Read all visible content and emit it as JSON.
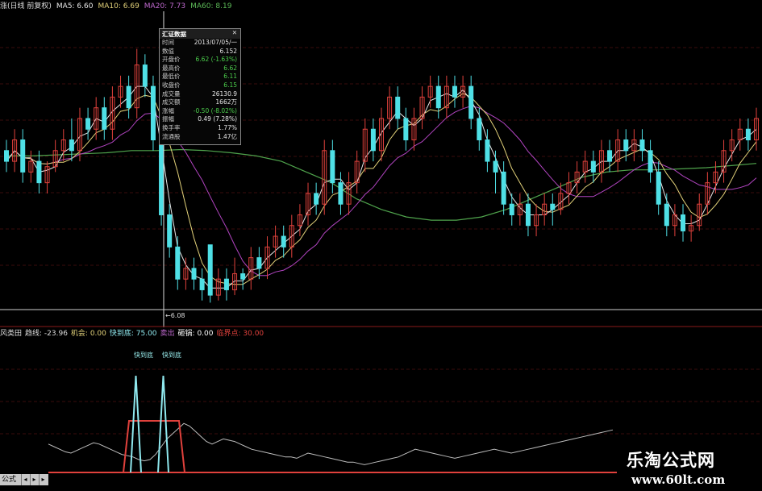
{
  "main_legend": {
    "prefix": "涨(日线 前复权)",
    "ma5": "MA5: 6.60",
    "ma10": "MA10: 6.69",
    "ma20": "MA20: 7.73",
    "ma60": "MA60: 8.19"
  },
  "info_panel": {
    "title": "汇证数据",
    "close": "✕",
    "rows": [
      {
        "label": "时间",
        "value": "2013/07/05/一"
      },
      {
        "label": "数值",
        "value": "6.152"
      },
      {
        "label": "开盘价",
        "value": "6.62 (-1.63%)"
      },
      {
        "label": "最高价",
        "value": "6.62"
      },
      {
        "label": "最低价",
        "value": "6.11"
      },
      {
        "label": "收盘价",
        "value": "6.15"
      },
      {
        "label": "成交量",
        "value": "26130.9"
      },
      {
        "label": "成交额",
        "value": "1662万"
      },
      {
        "label": "涨幅",
        "value": "-0.50 (-8.02%)"
      },
      {
        "label": "振幅",
        "value": "0.49 (7.28%)"
      },
      {
        "label": "换手率",
        "value": "1.77%"
      },
      {
        "label": "流通股",
        "value": "1.47亿"
      }
    ]
  },
  "low_label": "←6.08",
  "indicator_legend": {
    "name": "风类田",
    "trend": "趋线: -23.96",
    "chance": "机会: 0.00",
    "quick": "快到底: 75.00",
    "sell": "卖出",
    "buy": "砸锅: 0.00",
    "critical": "临界点: 30.00"
  },
  "signal_labels": [
    "快到底",
    "快到底"
  ],
  "bottom_bar": {
    "label": "公式",
    "btn1": "◂",
    "btn2": "▸",
    "btn3": "▸"
  },
  "watermark": {
    "title": "乐淘公式网",
    "url": "www.60lt.com"
  },
  "colors": {
    "up": "#e0413c",
    "down": "#4fe0e6",
    "ma5": "#e8e8e8",
    "ma10": "#e3d27a",
    "ma20": "#b144c0",
    "ma60": "#4fa34c"
  },
  "chart_data": {
    "type": "candlestick",
    "candles": [
      {
        "o": 7.5,
        "c": 7.4,
        "h": 7.6,
        "l": 7.3
      },
      {
        "o": 7.4,
        "c": 7.6,
        "h": 7.7,
        "l": 7.3
      },
      {
        "o": 7.6,
        "c": 7.3,
        "h": 7.7,
        "l": 7.2
      },
      {
        "o": 7.3,
        "c": 7.4,
        "h": 7.5,
        "l": 7.2
      },
      {
        "o": 7.4,
        "c": 7.2,
        "h": 7.5,
        "l": 7.1
      },
      {
        "o": 7.2,
        "c": 7.35,
        "h": 7.4,
        "l": 7.1
      },
      {
        "o": 7.35,
        "c": 7.5,
        "h": 7.6,
        "l": 7.3
      },
      {
        "o": 7.5,
        "c": 7.6,
        "h": 7.7,
        "l": 7.4
      },
      {
        "o": 7.6,
        "c": 7.5,
        "h": 7.8,
        "l": 7.4
      },
      {
        "o": 7.5,
        "c": 7.8,
        "h": 7.9,
        "l": 7.4
      },
      {
        "o": 7.8,
        "c": 7.7,
        "h": 7.9,
        "l": 7.6
      },
      {
        "o": 7.7,
        "c": 7.9,
        "h": 8.0,
        "l": 7.6
      },
      {
        "o": 7.9,
        "c": 7.7,
        "h": 8.0,
        "l": 7.6
      },
      {
        "o": 7.7,
        "c": 8.0,
        "h": 8.1,
        "l": 7.6
      },
      {
        "o": 8.0,
        "c": 8.1,
        "h": 8.2,
        "l": 7.9
      },
      {
        "o": 8.1,
        "c": 7.9,
        "h": 8.2,
        "l": 7.8
      },
      {
        "o": 7.9,
        "c": 8.3,
        "h": 8.45,
        "l": 7.8
      },
      {
        "o": 8.3,
        "c": 8.1,
        "h": 8.4,
        "l": 8.0
      },
      {
        "o": 8.1,
        "c": 7.6,
        "h": 8.2,
        "l": 7.5
      },
      {
        "o": 7.6,
        "c": 6.9,
        "h": 7.7,
        "l": 6.8
      },
      {
        "o": 6.9,
        "c": 6.6,
        "h": 7.0,
        "l": 6.5
      },
      {
        "o": 6.6,
        "c": 6.3,
        "h": 6.7,
        "l": 6.2
      },
      {
        "o": 6.3,
        "c": 6.4,
        "h": 6.5,
        "l": 6.2
      },
      {
        "o": 6.4,
        "c": 6.3,
        "h": 6.5,
        "l": 6.2
      },
      {
        "o": 6.3,
        "c": 6.2,
        "h": 6.4,
        "l": 6.1
      },
      {
        "o": 6.62,
        "c": 6.15,
        "h": 6.62,
        "l": 6.08
      },
      {
        "o": 6.15,
        "c": 6.3,
        "h": 6.4,
        "l": 6.1
      },
      {
        "o": 6.3,
        "c": 6.2,
        "h": 6.4,
        "l": 6.1
      },
      {
        "o": 6.2,
        "c": 6.35,
        "h": 6.5,
        "l": 6.15
      },
      {
        "o": 6.35,
        "c": 6.3,
        "h": 6.4,
        "l": 6.2
      },
      {
        "o": 6.3,
        "c": 6.5,
        "h": 6.6,
        "l": 6.2
      },
      {
        "o": 6.5,
        "c": 6.4,
        "h": 6.6,
        "l": 6.3
      },
      {
        "o": 6.4,
        "c": 6.6,
        "h": 6.7,
        "l": 6.3
      },
      {
        "o": 6.6,
        "c": 6.7,
        "h": 6.8,
        "l": 6.5
      },
      {
        "o": 6.7,
        "c": 6.6,
        "h": 6.8,
        "l": 6.5
      },
      {
        "o": 6.6,
        "c": 6.8,
        "h": 6.9,
        "l": 6.5
      },
      {
        "o": 6.8,
        "c": 6.9,
        "h": 7.0,
        "l": 6.7
      },
      {
        "o": 6.9,
        "c": 7.1,
        "h": 7.2,
        "l": 6.8
      },
      {
        "o": 7.1,
        "c": 7.0,
        "h": 7.2,
        "l": 6.9
      },
      {
        "o": 7.0,
        "c": 7.5,
        "h": 7.6,
        "l": 6.9
      },
      {
        "o": 7.5,
        "c": 7.2,
        "h": 7.6,
        "l": 7.1
      },
      {
        "o": 7.2,
        "c": 7.0,
        "h": 7.3,
        "l": 6.9
      },
      {
        "o": 7.0,
        "c": 7.2,
        "h": 7.3,
        "l": 6.9
      },
      {
        "o": 7.2,
        "c": 7.4,
        "h": 7.5,
        "l": 7.1
      },
      {
        "o": 7.4,
        "c": 7.7,
        "h": 7.8,
        "l": 7.3
      },
      {
        "o": 7.7,
        "c": 7.5,
        "h": 7.8,
        "l": 7.4
      },
      {
        "o": 7.5,
        "c": 7.8,
        "h": 7.9,
        "l": 7.4
      },
      {
        "o": 7.8,
        "c": 8.0,
        "h": 8.1,
        "l": 7.7
      },
      {
        "o": 8.0,
        "c": 7.8,
        "h": 8.1,
        "l": 7.7
      },
      {
        "o": 7.8,
        "c": 7.6,
        "h": 7.9,
        "l": 7.5
      },
      {
        "o": 7.6,
        "c": 7.8,
        "h": 7.9,
        "l": 7.5
      },
      {
        "o": 7.8,
        "c": 8.0,
        "h": 8.1,
        "l": 7.7
      },
      {
        "o": 8.0,
        "c": 8.1,
        "h": 8.2,
        "l": 7.9
      },
      {
        "o": 8.1,
        "c": 7.9,
        "h": 8.2,
        "l": 7.8
      },
      {
        "o": 7.9,
        "c": 8.1,
        "h": 8.2,
        "l": 7.8
      },
      {
        "o": 8.1,
        "c": 8.0,
        "h": 8.2,
        "l": 7.9
      },
      {
        "o": 8.0,
        "c": 8.1,
        "h": 8.2,
        "l": 7.9
      },
      {
        "o": 8.1,
        "c": 7.8,
        "h": 8.2,
        "l": 7.7
      },
      {
        "o": 7.8,
        "c": 7.6,
        "h": 7.9,
        "l": 7.5
      },
      {
        "o": 7.6,
        "c": 7.4,
        "h": 7.7,
        "l": 7.3
      },
      {
        "o": 7.4,
        "c": 7.3,
        "h": 7.5,
        "l": 7.1
      },
      {
        "o": 7.3,
        "c": 7.0,
        "h": 7.4,
        "l": 6.9
      },
      {
        "o": 7.0,
        "c": 6.9,
        "h": 7.1,
        "l": 6.8
      },
      {
        "o": 6.9,
        "c": 7.0,
        "h": 7.1,
        "l": 6.8
      },
      {
        "o": 7.0,
        "c": 6.8,
        "h": 7.1,
        "l": 6.7
      },
      {
        "o": 6.8,
        "c": 6.9,
        "h": 7.0,
        "l": 6.7
      },
      {
        "o": 6.9,
        "c": 7.0,
        "h": 7.1,
        "l": 6.8
      },
      {
        "o": 7.0,
        "c": 6.95,
        "h": 7.1,
        "l": 6.8
      },
      {
        "o": 6.95,
        "c": 7.1,
        "h": 7.2,
        "l": 6.9
      },
      {
        "o": 7.1,
        "c": 7.2,
        "h": 7.3,
        "l": 7.0
      },
      {
        "o": 7.2,
        "c": 7.3,
        "h": 7.4,
        "l": 7.1
      },
      {
        "o": 7.3,
        "c": 7.4,
        "h": 7.5,
        "l": 7.2
      },
      {
        "o": 7.4,
        "c": 7.3,
        "h": 7.5,
        "l": 7.2
      },
      {
        "o": 7.3,
        "c": 7.5,
        "h": 7.6,
        "l": 7.2
      },
      {
        "o": 7.5,
        "c": 7.4,
        "h": 7.6,
        "l": 7.3
      },
      {
        "o": 7.4,
        "c": 7.6,
        "h": 7.7,
        "l": 7.3
      },
      {
        "o": 7.6,
        "c": 7.5,
        "h": 7.7,
        "l": 7.4
      },
      {
        "o": 7.5,
        "c": 7.6,
        "h": 7.7,
        "l": 7.4
      },
      {
        "o": 7.6,
        "c": 7.5,
        "h": 7.7,
        "l": 7.4
      },
      {
        "o": 7.5,
        "c": 7.3,
        "h": 7.6,
        "l": 7.2
      },
      {
        "o": 7.3,
        "c": 7.0,
        "h": 7.4,
        "l": 6.9
      },
      {
        "o": 7.0,
        "c": 6.8,
        "h": 7.1,
        "l": 6.7
      },
      {
        "o": 6.8,
        "c": 6.9,
        "h": 7.0,
        "l": 6.7
      },
      {
        "o": 6.9,
        "c": 6.75,
        "h": 7.0,
        "l": 6.65
      },
      {
        "o": 6.75,
        "c": 6.8,
        "h": 6.9,
        "l": 6.65
      },
      {
        "o": 6.8,
        "c": 7.0,
        "h": 7.1,
        "l": 6.75
      },
      {
        "o": 7.0,
        "c": 7.2,
        "h": 7.3,
        "l": 6.9
      },
      {
        "o": 7.2,
        "c": 7.3,
        "h": 7.4,
        "l": 7.1
      },
      {
        "o": 7.3,
        "c": 7.5,
        "h": 7.6,
        "l": 7.2
      },
      {
        "o": 7.5,
        "c": 7.6,
        "h": 7.7,
        "l": 7.4
      },
      {
        "o": 7.6,
        "c": 7.7,
        "h": 7.8,
        "l": 7.5
      },
      {
        "o": 7.7,
        "c": 7.6,
        "h": 7.8,
        "l": 7.5
      },
      {
        "o": 7.6,
        "c": 7.8,
        "h": 7.9,
        "l": 7.5
      }
    ],
    "ma60": [
      7.45,
      7.45,
      7.46,
      7.47,
      7.48,
      7.5,
      7.5,
      7.51,
      7.5,
      7.48,
      7.45,
      7.4,
      7.3,
      7.2,
      7.05,
      6.95,
      6.88,
      6.85,
      6.85,
      6.88,
      6.95,
      7.05,
      7.15,
      7.25,
      7.3,
      7.32,
      7.32,
      7.33,
      7.34,
      7.36,
      7.38
    ]
  },
  "indicator_data": {
    "critical_level": 30,
    "quick_bottom_level": 75,
    "oscillator": [
      22,
      20,
      18,
      16,
      15,
      17,
      19,
      21,
      23,
      22,
      20,
      18,
      16,
      14,
      13,
      12,
      10,
      9,
      10,
      14,
      20,
      26,
      30,
      34,
      38,
      36,
      32,
      28,
      24,
      22,
      24,
      26,
      25,
      24,
      22,
      20,
      18,
      17,
      16,
      15,
      14,
      13,
      12,
      12,
      11,
      13,
      15,
      14,
      13,
      12,
      11,
      10,
      9,
      8,
      8,
      7,
      6,
      7,
      8,
      9,
      10,
      11,
      12,
      14,
      16,
      18,
      17,
      16,
      15,
      14,
      13,
      12,
      11,
      12,
      13,
      14,
      15,
      16,
      17,
      18,
      17,
      16,
      15,
      16,
      17,
      18,
      19,
      20,
      21,
      22,
      23,
      24,
      25,
      26,
      27,
      28,
      29,
      30,
      31,
      32,
      33
    ]
  }
}
